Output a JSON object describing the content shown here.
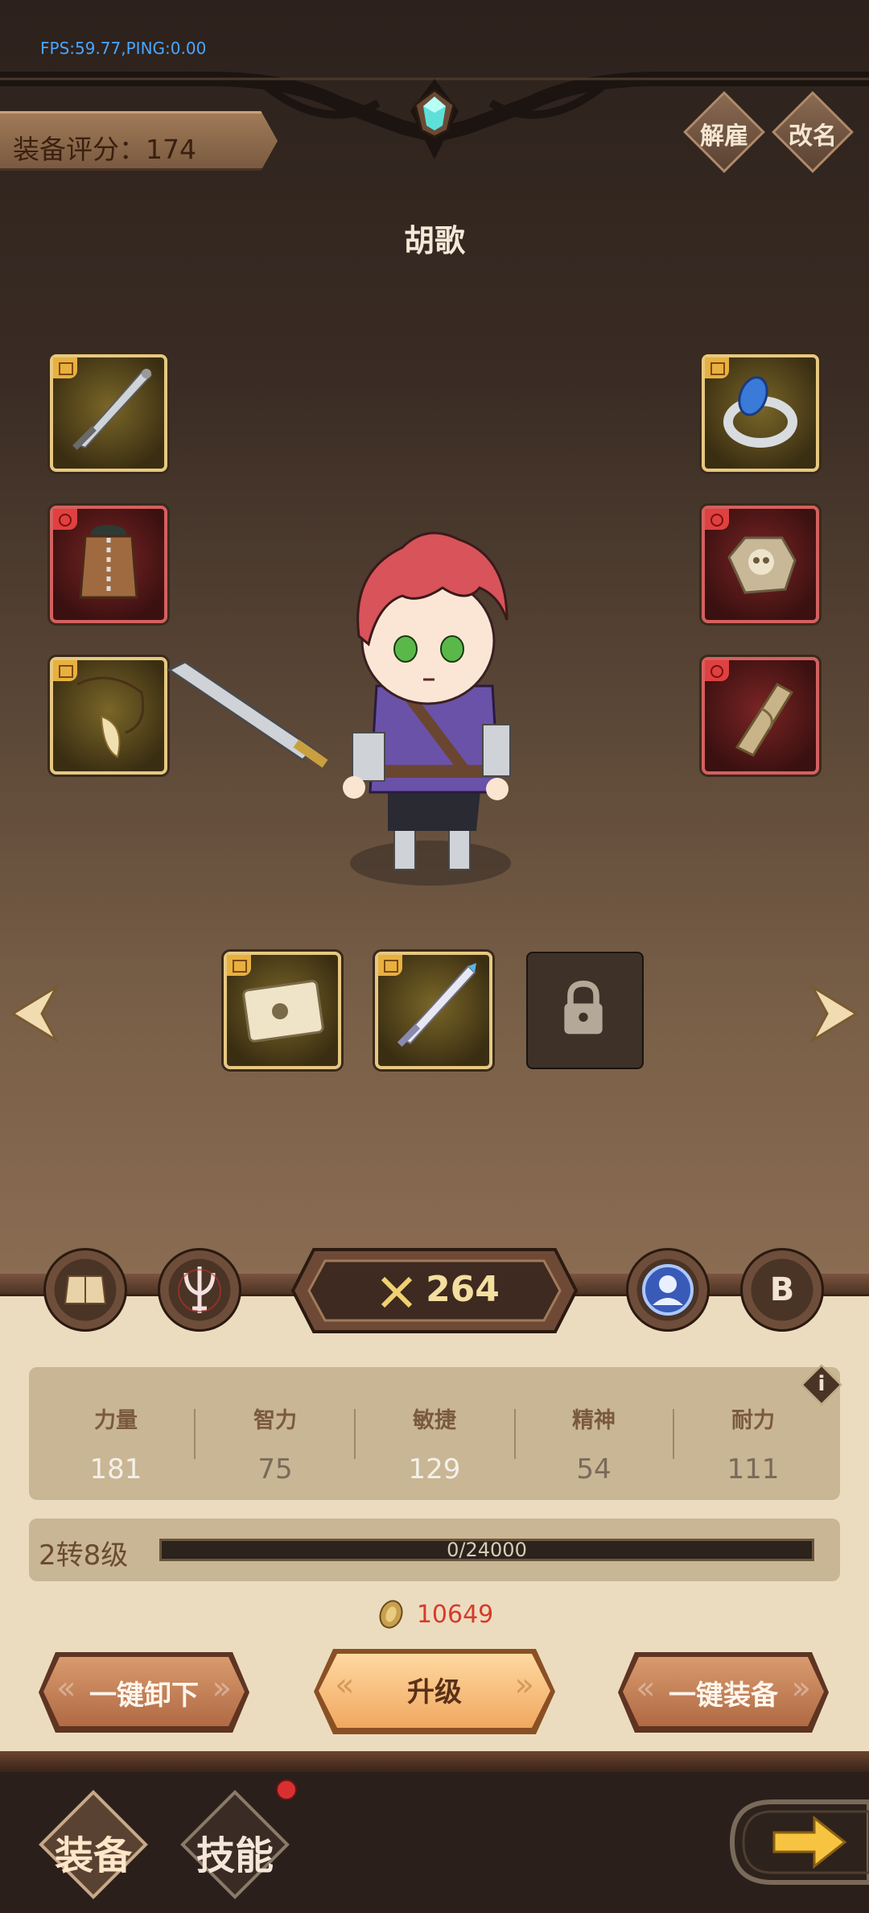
{
  "debug": {
    "fps_text": "FPS:59.77,PING:0.00"
  },
  "header": {
    "rating_text": "装备评分：174",
    "dismiss_label": "解雇",
    "rename_label": "改名",
    "hero_name": "胡歌"
  },
  "equipment": {
    "left": [
      {
        "name": "sword-item",
        "rarity": "gold"
      },
      {
        "name": "vest-item",
        "rarity": "red"
      },
      {
        "name": "horn-necklace-item",
        "rarity": "gold"
      }
    ],
    "right": [
      {
        "name": "ring-item",
        "rarity": "gold"
      },
      {
        "name": "skull-stone-item",
        "rarity": "red"
      },
      {
        "name": "leg-bone-item",
        "rarity": "red"
      }
    ],
    "extra": [
      {
        "name": "scroll-item",
        "rarity": "gold"
      },
      {
        "name": "crystal-sword-item",
        "rarity": "gold"
      },
      {
        "name": "locked-slot",
        "rarity": "locked"
      }
    ]
  },
  "toolbar": {
    "combat_power": "264",
    "b_label": "B"
  },
  "stats": [
    {
      "label": "力量",
      "value": "181",
      "highlight": true
    },
    {
      "label": "智力",
      "value": "75",
      "highlight": false
    },
    {
      "label": "敏捷",
      "value": "129",
      "highlight": true
    },
    {
      "label": "精神",
      "value": "54",
      "highlight": false
    },
    {
      "label": "耐力",
      "value": "111",
      "highlight": false
    }
  ],
  "info_label": "i",
  "level": {
    "label": "2转8级",
    "exp_text": "0/24000",
    "exp_fraction": 0
  },
  "gold_amount": "10649",
  "actions": {
    "unequip_all": "一键卸下",
    "upgrade": "升级",
    "equip_all": "一键装备"
  },
  "nav": {
    "equip_tab": "装备",
    "skill_tab": "技能"
  },
  "colors": {
    "gold_rarity": "#e6c882",
    "red_rarity": "#d46060",
    "gold_text": "#d83a2a",
    "fps_text": "#4aa6ff"
  }
}
